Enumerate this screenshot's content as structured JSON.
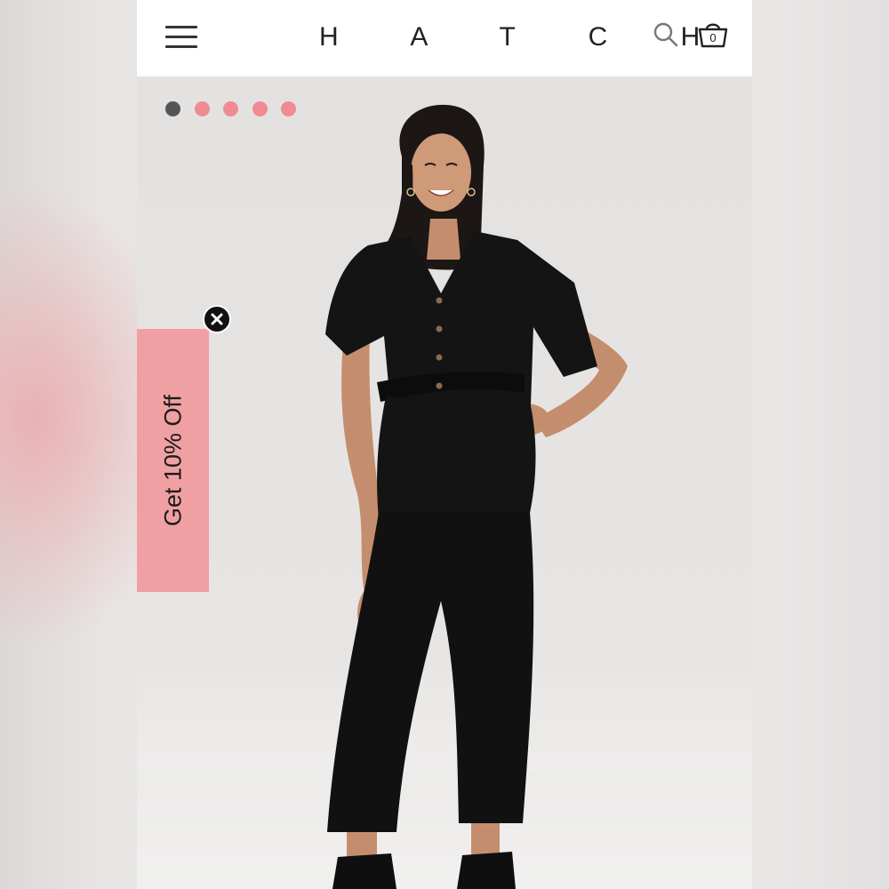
{
  "header": {
    "logo": "H A T C H",
    "menu_icon": "hamburger-menu-icon",
    "search_icon": "search-icon",
    "cart_icon": "shopping-basket-icon",
    "cart_count": "0"
  },
  "carousel": {
    "total_slides": 5,
    "active_index": 0,
    "active_color": "#555555",
    "inactive_color": "#f08a93"
  },
  "promo": {
    "label": "Get 10% Off",
    "background": "#f0a0a3",
    "close_icon": "close-icon"
  },
  "product_image": {
    "subject": "model-in-black-jumpsuit"
  }
}
